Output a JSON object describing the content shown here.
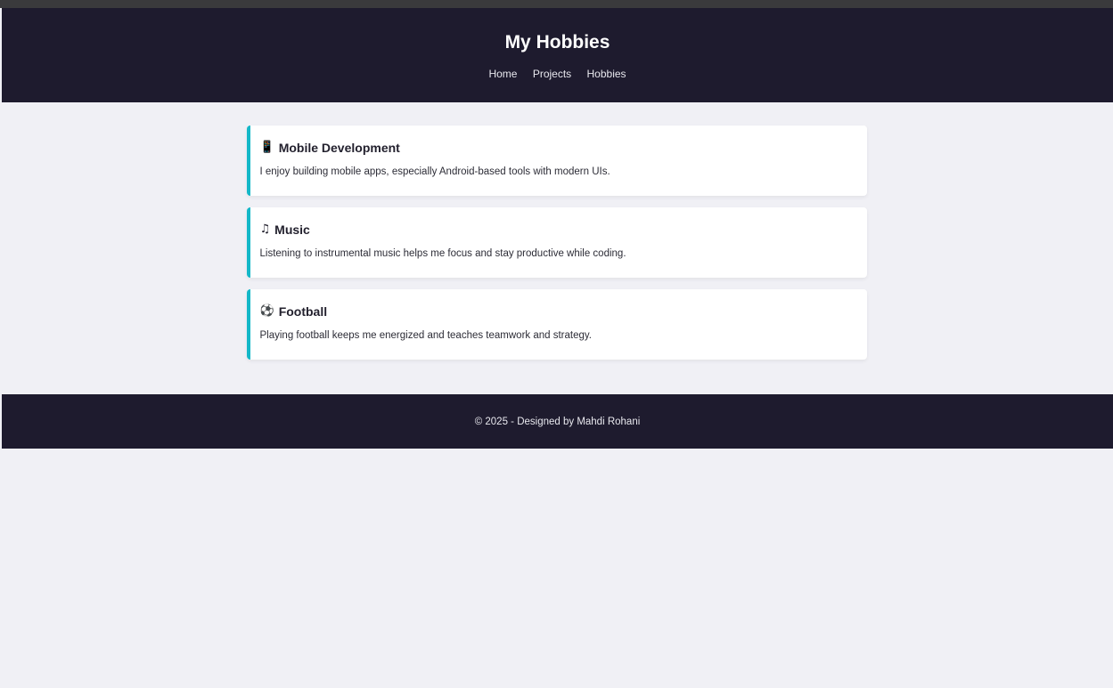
{
  "header": {
    "title": "My Hobbies",
    "nav": [
      "Home",
      "Projects",
      "Hobbies"
    ]
  },
  "hobbies": [
    {
      "icon": "mobile-phone-icon",
      "glyph": "📱",
      "title": "Mobile Development",
      "description": "I enjoy building mobile apps, especially Android-based tools with modern UIs."
    },
    {
      "icon": "music-note-icon",
      "glyph": "♫",
      "title": "Music",
      "description": "Listening to instrumental music helps me focus and stay productive while coding."
    },
    {
      "icon": "soccer-ball-icon",
      "glyph": "⚽",
      "title": "Football",
      "description": "Playing football keeps me energized and teaches teamwork and strategy."
    }
  ],
  "footer": {
    "text": "© 2025 - Designed by Mahdi Rohani"
  },
  "colors": {
    "header_bg": "#1e1b2e",
    "page_bg": "#f0f0f5",
    "accent": "#14b8c8",
    "card_bg": "#ffffff"
  }
}
